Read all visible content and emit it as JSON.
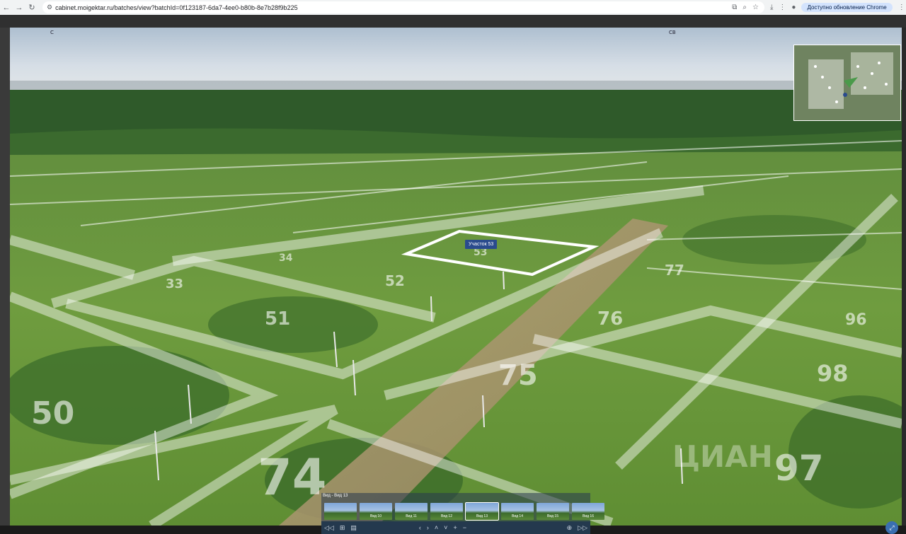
{
  "browser": {
    "url": "cabinet.moigektar.ru/batches/view?batchId=0f123187-6da7-4ee0-b80b-8e7b28f9b225",
    "update_button": "Доступно обновление Chrome"
  },
  "compass": {
    "north": "С",
    "north_east": "СВ"
  },
  "plot_tooltip": "Участок 53",
  "gallery": {
    "title": "Вид - Вид 13",
    "thumbnails": [
      {
        "label": ""
      },
      {
        "label": "Вид 10"
      },
      {
        "label": "Вид 11"
      },
      {
        "label": "Вид 12"
      },
      {
        "label": "Вид 13"
      },
      {
        "label": "Вид 14"
      },
      {
        "label": "Вид 15"
      },
      {
        "label": "Вид 16"
      }
    ]
  },
  "plot_numbers": [
    "74",
    "75",
    "76",
    "77",
    "50",
    "51",
    "52",
    "53",
    "33",
    "34",
    "96",
    "97",
    "98"
  ],
  "colors": {
    "accent": "#2a4b8d",
    "plot_line": "#ffffff",
    "field": "#6c9a3c",
    "forest": "#2f5a2a",
    "sky": "#c9d6e2"
  }
}
